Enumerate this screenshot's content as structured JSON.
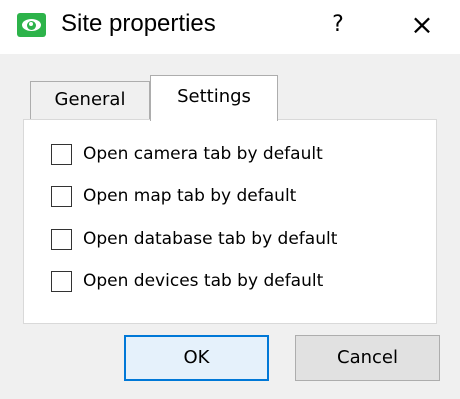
{
  "window": {
    "title": "Site properties",
    "help_label": "?",
    "close_label": "×",
    "app_icon": "eye-icon",
    "app_icon_color": "#2db34a"
  },
  "tabs": [
    {
      "label": "General",
      "selected": false
    },
    {
      "label": "Settings",
      "selected": true
    }
  ],
  "settings": {
    "options": [
      {
        "label": "Open camera tab by default",
        "checked": false
      },
      {
        "label": "Open map tab by default",
        "checked": false
      },
      {
        "label": "Open database tab by default",
        "checked": false
      },
      {
        "label": "Open devices tab by default",
        "checked": false
      }
    ]
  },
  "buttons": {
    "ok_label": "OK",
    "cancel_label": "Cancel",
    "accent": "#0078d7"
  }
}
